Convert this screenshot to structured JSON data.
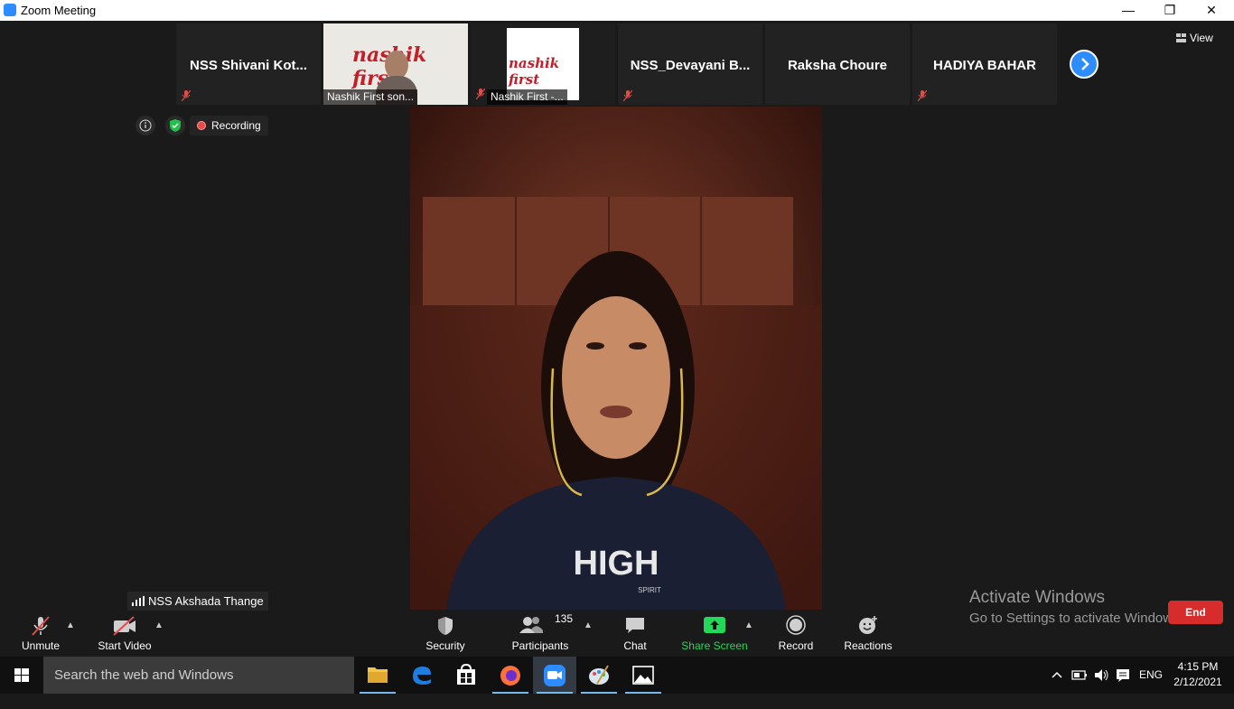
{
  "window": {
    "title": "Zoom Meeting",
    "minimize": "—",
    "restore": "❐",
    "close": "✕"
  },
  "strip": {
    "tiles": [
      {
        "name": "NSS  Shivani  Kot..."
      },
      {
        "caption": "Nashik First son..."
      },
      {
        "caption": "Nashik First -..."
      },
      {
        "name": "NSS_Devayani  B..."
      },
      {
        "name": "Raksha Choure"
      },
      {
        "name": "HADIYA BAHAR"
      }
    ],
    "logo_text": "nashik first",
    "view_label": "View"
  },
  "status": {
    "recording_label": "Recording"
  },
  "main": {
    "speaker_name": "NSS Akshada Thange",
    "shirt_text": "HIGH",
    "shirt_subtext": "SPIRIT"
  },
  "watermark": {
    "line1": "Activate Windows",
    "line2": "Go to Settings to activate Windows."
  },
  "toolbar": {
    "unmute": "Unmute",
    "start_video": "Start Video",
    "security": "Security",
    "participants": "Participants",
    "participants_count": "135",
    "chat": "Chat",
    "share_screen": "Share Screen",
    "record": "Record",
    "reactions": "Reactions",
    "end": "End",
    "share_color": "#23d959"
  },
  "taskbar": {
    "search_placeholder": "Search the web and Windows",
    "language": "ENG",
    "time": "4:15 PM",
    "date": "2/12/2021"
  }
}
